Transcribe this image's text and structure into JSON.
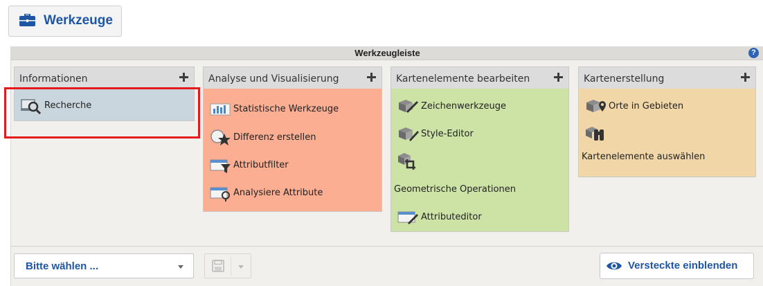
{
  "tools_button": {
    "label": "Werkzeuge",
    "icon": "briefcase-icon"
  },
  "toolbar": {
    "title": "Werkzeugleiste",
    "help_icon": "help-icon",
    "help_glyph": "?"
  },
  "groups": [
    {
      "title": "Informationen",
      "color": "#c9d6dd",
      "items": [
        {
          "label": "Recherche",
          "icon": "search-map-icon"
        }
      ]
    },
    {
      "title": "Analyse und Visualisierung",
      "color": "#fbae92",
      "items": [
        {
          "label": "Statistische Werkzeuge",
          "icon": "bar-chart-icon"
        },
        {
          "label": "Differenz erstellen",
          "icon": "difference-star-icon"
        },
        {
          "label": "Attributfilter",
          "icon": "filter-icon"
        },
        {
          "label": "Analysiere Attribute",
          "icon": "analyze-attributes-icon"
        }
      ]
    },
    {
      "title": "Kartenelemente bearbeiten",
      "color": "#cde3a6",
      "items": [
        {
          "label": "Zeichenwerkzeuge",
          "icon": "draw-pencil-icon"
        },
        {
          "label": "Style-Editor",
          "icon": "style-editor-icon"
        },
        {
          "label": "Geometrische Operationen",
          "icon": "crop-icon"
        },
        {
          "label": "Attributeditor",
          "icon": "attribute-editor-icon"
        }
      ]
    },
    {
      "title": "Kartenerstellung",
      "color": "#f1d6a8",
      "items": [
        {
          "label": "Orte in Gebieten",
          "icon": "place-pin-icon"
        },
        {
          "label": "Kartenelemente auswählen",
          "icon": "binoculars-icon"
        }
      ]
    }
  ],
  "bottom": {
    "select_value": "Bitte wählen ...",
    "save_icon": "save-icon",
    "show_hidden_label": "Versteckte einblenden",
    "show_hidden_icon": "eye-icon"
  },
  "colors": {
    "accent": "#1f56a4",
    "highlight_border": "#e41a1c",
    "help_blue": "#2e63b8"
  }
}
